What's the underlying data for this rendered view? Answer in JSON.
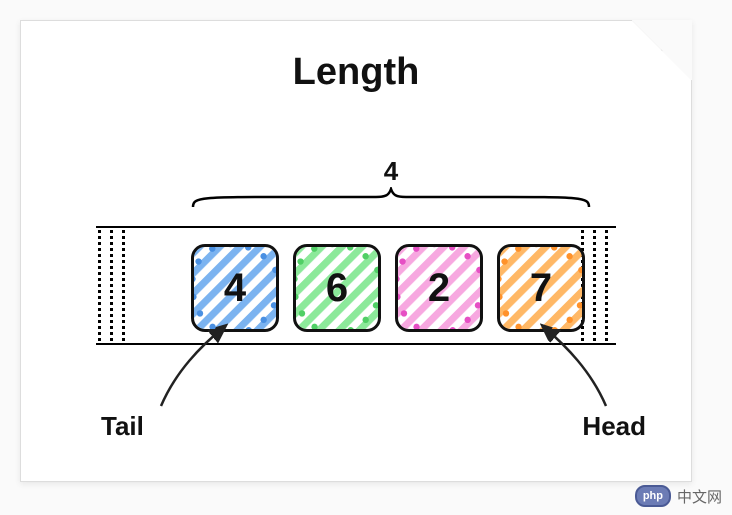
{
  "title": "Length",
  "length_value": "4",
  "labels": {
    "tail": "Tail",
    "head": "Head"
  },
  "nodes": [
    {
      "value": "4",
      "stripe_color": "#7bb3f0",
      "dot_color": "#4a90e2"
    },
    {
      "value": "6",
      "stripe_color": "#8ce99a",
      "dot_color": "#51cf66"
    },
    {
      "value": "2",
      "stripe_color": "#f7a8e0",
      "dot_color": "#e64fc4"
    },
    {
      "value": "7",
      "stripe_color": "#ffb866",
      "dot_color": "#ff922b"
    }
  ],
  "watermark": {
    "badge": "php",
    "text": "中文网"
  },
  "chart_data": {
    "type": "diagram",
    "structure": "queue",
    "title": "Length",
    "length": 4,
    "elements": [
      4,
      6,
      2,
      7
    ],
    "tail_index": 0,
    "head_index": 3,
    "annotations": [
      "Tail points to first element (4)",
      "Head points to last element (7)",
      "Curly brace spans all 4 elements showing length"
    ]
  }
}
